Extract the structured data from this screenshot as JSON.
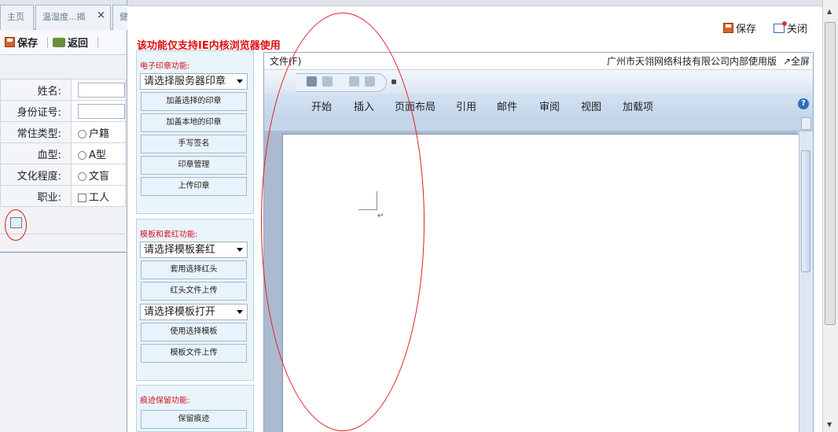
{
  "tabs": [
    {
      "label": "主页"
    },
    {
      "label": "温湿度...揭",
      "close": "×"
    },
    {
      "label": "健"
    }
  ],
  "toolbar": {
    "save_label": "保存",
    "back_label": "返回"
  },
  "form": {
    "fields": [
      {
        "label": "姓名:",
        "type": "text",
        "value": ""
      },
      {
        "label": "身份证号:",
        "type": "text",
        "value": ""
      },
      {
        "label": "常住类型:",
        "type": "radio",
        "value": "户籍"
      },
      {
        "label": "血型:",
        "type": "radio",
        "value": "A型"
      },
      {
        "label": "文化程度:",
        "type": "radio",
        "value": "文盲"
      },
      {
        "label": "职业:",
        "type": "checkbox",
        "value": "工人"
      }
    ]
  },
  "dialog": {
    "save_label": "保存",
    "close_label": "关闭",
    "warning": "该功能仅支持IE内核浏览器使用"
  },
  "seal": {
    "title": "电子印章功能:",
    "select": "请选择服务器印章",
    "buttons": [
      "加盖选择的印章",
      "加盖本地的印章",
      "手写签名",
      "印章管理",
      "上传印章"
    ]
  },
  "template": {
    "title": "模板和套红功能:",
    "select1": "请选择模板套红",
    "buttons1": [
      "套用选择红头",
      "红头文件上传"
    ],
    "select2": "请选择模板打开",
    "buttons2": [
      "使用选择模板",
      "模板文件上传"
    ]
  },
  "trace": {
    "title": "痕迹保留功能:",
    "buttons": [
      "保留痕迹"
    ]
  },
  "word": {
    "file_menu": "文件(F)",
    "company": "广州市天翎网络科技有限公司内部使用版",
    "fullscreen": "↗全屏",
    "ribbon_tabs": [
      "开始",
      "插入",
      "页面布局",
      "引用",
      "邮件",
      "审阅",
      "视图",
      "加载项"
    ],
    "paragraph_mark": "↵",
    "help": "?"
  },
  "scroll": {
    "up": "▲",
    "down": "▼"
  },
  "colors": {
    "warning_red": "#e01010",
    "annotation_red": "#e31b1b",
    "group_bg": "#eaf4fb"
  }
}
